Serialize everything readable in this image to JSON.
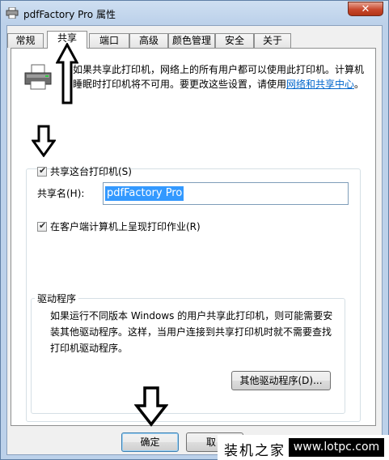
{
  "window": {
    "title": "pdfFactory Pro 属性",
    "close_glyph": "✕"
  },
  "tabs": [
    {
      "label": "常规",
      "active": false
    },
    {
      "label": "共享",
      "active": true
    },
    {
      "label": "端口",
      "active": false
    },
    {
      "label": "高级",
      "active": false
    },
    {
      "label": "颜色管理",
      "active": false
    },
    {
      "label": "安全",
      "active": false
    },
    {
      "label": "关于",
      "active": false
    }
  ],
  "share_tab": {
    "intro_line1": "如果共享此打印机，网络上的所有用户都可以使用此打印机。计算机",
    "intro_line2_prefix": "睡眠时打印机将不可用。要更改这些设置，请使用",
    "intro_link": "网络和共享中心",
    "intro_suffix": "。",
    "share_checkbox_label": "共享这台打印机(S)",
    "share_checked": true,
    "share_name_label": "共享名(H):",
    "share_name_value": "pdfFactory Pro",
    "render_jobs_label": "在客户端计算机上呈现打印作业(R)",
    "render_jobs_checked": true,
    "drivers_title": "驱动程序",
    "drivers_text": "如果运行不同版本 Windows 的用户共享此打印机，则可能需要安装其他驱动程序。这样，当用户连接到共享打印机时就不需要查找打印机驱动程序。",
    "other_drivers_button": "其他驱动程序(D)..."
  },
  "footer": {
    "ok_button": "确定",
    "cancel_button": "取"
  },
  "watermark": {
    "text": "装机之家",
    "url": "www.lotpc.com"
  },
  "icons": {
    "window": "printer-icon",
    "page": "printer-icon",
    "close": "close-icon",
    "annotation": "up-arrow-icon"
  },
  "colors": {
    "link": "#0066cc",
    "selection": "#3399ff",
    "close": "#c8472c"
  }
}
